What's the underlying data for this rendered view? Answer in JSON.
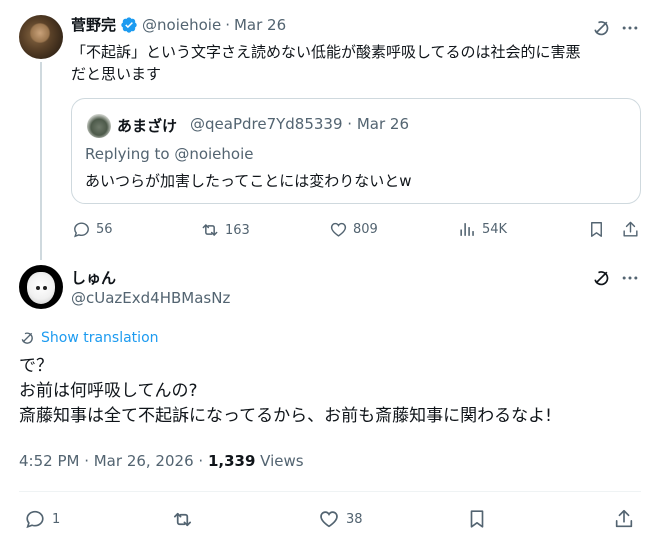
{
  "tweet1": {
    "display_name": "菅野完",
    "handle": "@noiehoie",
    "date": "Mar 26",
    "text_line1": "「不起訴」という文字さえ読めない低能が酸素呼吸してるのは社会的に害悪",
    "text_line2": "だと思います",
    "actions": {
      "replies": "56",
      "reposts": "163",
      "likes": "809",
      "views": "54K"
    }
  },
  "quote": {
    "display_name": "あまざけ",
    "handle": "@qeaPdre7Yd85339",
    "date": "Mar 26",
    "replying_to": "Replying to @noiehoie",
    "text": "あいつらが加害したってことには変わりないとw"
  },
  "tweet2": {
    "display_name": "しゅん",
    "handle": "@cUazExd4HBMasNz",
    "show_translation": "Show translation",
    "lines": [
      "で？",
      "お前は何呼吸してんの?",
      "斎藤知事は全て不起訴になってるから、お前も斎藤知事に関わるなよ!"
    ],
    "timestamp": "4:52 PM · Mar 26, 2026 ·",
    "views_count": "1,339",
    "views_label": "Views",
    "actions": {
      "replies": "1",
      "likes": "38"
    }
  },
  "colors": {
    "accent": "#1d9bf0",
    "muted": "#536471",
    "border": "#cfd9de"
  },
  "icons": [
    "verified-badge-icon",
    "grok-icon",
    "more-icon",
    "reply-icon",
    "repost-icon",
    "like-icon",
    "views-icon",
    "bookmark-icon",
    "share-icon",
    "translate-icon"
  ]
}
